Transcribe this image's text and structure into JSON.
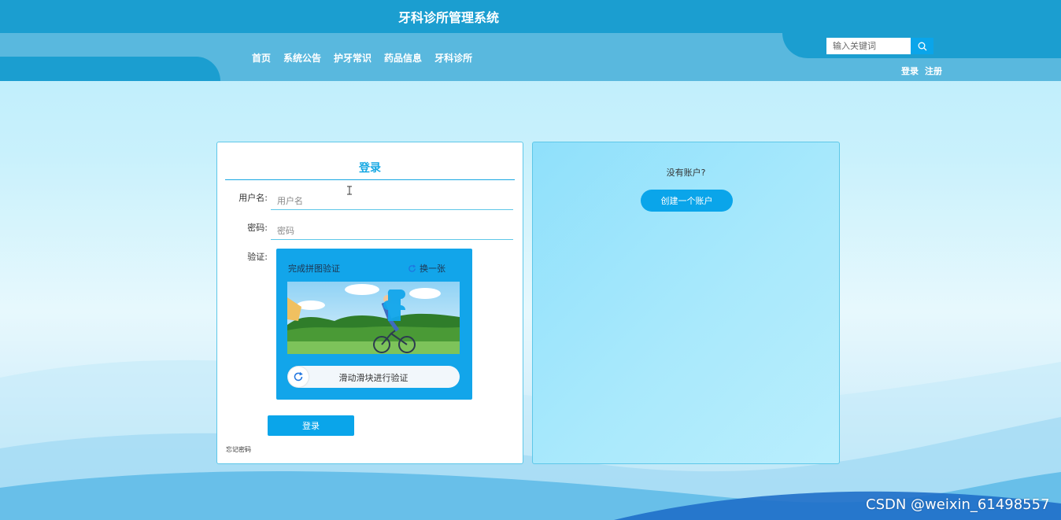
{
  "header": {
    "site_title": "牙科诊所管理系统",
    "nav": [
      "首页",
      "系统公告",
      "护牙常识",
      "药品信息",
      "牙科诊所"
    ],
    "search_placeholder": "输入关键词",
    "login_link": "登录",
    "register_link": "注册"
  },
  "login": {
    "title": "登录",
    "username_label": "用户名:",
    "username_placeholder": "用户名",
    "password_label": "密码:",
    "password_placeholder": "密码",
    "verify_label": "验证:",
    "captcha": {
      "title": "完成拼图验证",
      "refresh_label": "换一张",
      "slider_text": "滑动滑块进行验证"
    },
    "submit_label": "登录",
    "forgot_label": "忘记密码"
  },
  "register": {
    "prompt": "没有账户?",
    "create_label": "创建一个账户"
  },
  "watermark": "CSDN @weixin_61498557",
  "colors": {
    "header": "#1b9ed0",
    "nav_band": "#59b8de",
    "accent": "#0aa5ea",
    "title_text": "#17a8e3"
  }
}
